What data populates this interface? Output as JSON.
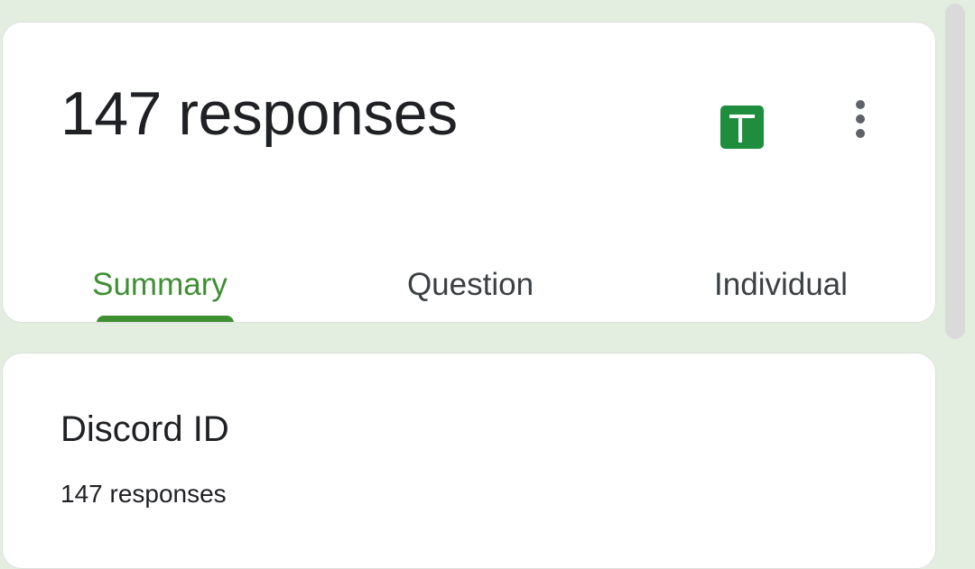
{
  "header": {
    "title": "147 responses"
  },
  "tabs": [
    {
      "label": "Summary",
      "active": true
    },
    {
      "label": "Question",
      "active": false
    },
    {
      "label": "Individual",
      "active": false
    }
  ],
  "question": {
    "title": "Discord ID",
    "response_count": "147 responses"
  },
  "icons": {
    "sheets": "google-sheets-icon",
    "more": "more-vert-icon"
  },
  "colors": {
    "background": "#e3eee1",
    "accent": "#3f8f33",
    "sheets_green": "#1e8e3e",
    "text": "#202124"
  }
}
